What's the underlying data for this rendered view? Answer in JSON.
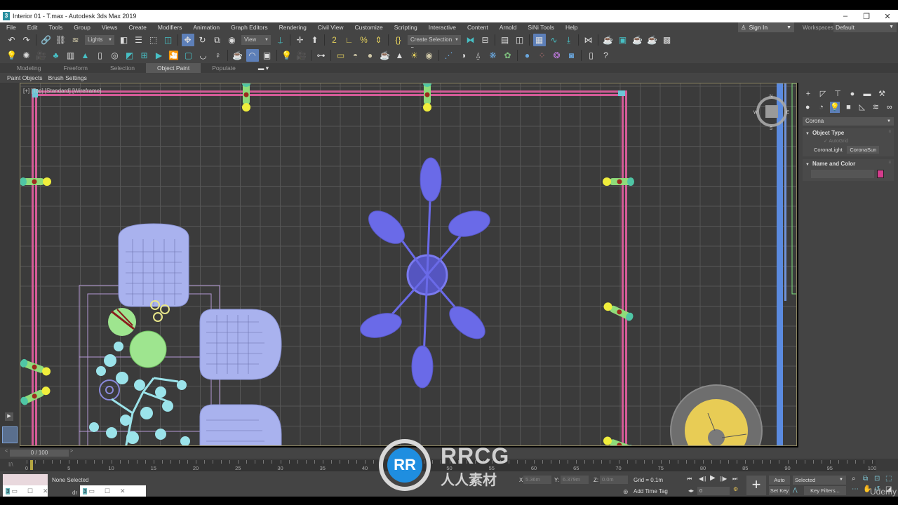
{
  "window": {
    "title": "Interior 01 - T.max - Autodesk 3ds Max 2019",
    "app_icon": "3",
    "controls": [
      "minimize-icon",
      "restore-icon",
      "close-icon"
    ]
  },
  "menu": {
    "items": [
      "File",
      "Edit",
      "Tools",
      "Group",
      "Views",
      "Create",
      "Modifiers",
      "Animation",
      "Graph Editors",
      "Rendering",
      "Civil View",
      "Customize",
      "Scripting",
      "Interactive",
      "Content",
      "Arnold",
      "SiNi Tools",
      "Help"
    ],
    "sign_in": "Sign In",
    "workspaces_label": "Workspaces:",
    "workspace_value": "Default"
  },
  "toolbar_main": {
    "selection_filter": "Lights",
    "ref_coord": "View",
    "named_selection": "Create Selection Se",
    "active_tool": "select-and-move"
  },
  "ribbon": {
    "tabs": [
      "Modeling",
      "Freeform",
      "Selection",
      "Object Paint",
      "Populate"
    ],
    "active_tab": "Object Paint",
    "sub_items": [
      "Paint Objects",
      "Brush Settings"
    ]
  },
  "viewport": {
    "label": "[+] [Top] [Standard] [Wireframe]",
    "viewcube_letters": {
      "n": "N",
      "s": "S",
      "e": "E",
      "w": "W"
    },
    "colors": {
      "background": "#3b3b3b",
      "grid": "#565656",
      "wall_pink": "#d45b97",
      "wall_blue": "#5b8be0",
      "chandelier": "#6a6ae8",
      "chair": "#a9b2ee",
      "plant": "#9be3ea",
      "green_disc": "#9ee58f",
      "yellow_light": "#f0ee3c",
      "lamp_globe": "#e8cc55"
    }
  },
  "command_panel": {
    "tabs": [
      "create",
      "modify",
      "hierarchy",
      "motion",
      "display",
      "utilities"
    ],
    "categories": [
      "geometry",
      "shapes",
      "lights",
      "cameras",
      "helpers",
      "space-warps",
      "systems"
    ],
    "active_category": "lights",
    "renderer_dropdown": "Corona",
    "object_type": {
      "title": "Object Type",
      "autogrid": "AutoGrid",
      "buttons": [
        "CoronaLight",
        "CoronaSun"
      ]
    },
    "name_and_color": {
      "title": "Name and Color",
      "name_value": "",
      "color": "#d43c8c"
    }
  },
  "timeline": {
    "slider_text": "0 / 100",
    "prev": "<",
    "next": ">",
    "ticks": [
      0,
      5,
      10,
      15,
      20,
      25,
      30,
      35,
      40,
      45,
      50,
      55,
      60,
      65,
      70,
      75,
      80,
      85,
      90,
      95,
      100
    ],
    "current_frame": 0
  },
  "status": {
    "selection": "None Selected",
    "x_label": "X:",
    "x_value": "5.36m",
    "y_label": "Y:",
    "y_value": "6.379m",
    "z_label": "Z:",
    "z_value": "0.0m",
    "grid": "Grid = 0.1m",
    "add_time_tag": "Add Time Tag",
    "frame_value": "0",
    "auto_key": "Auto Key",
    "set_key": "Set Key",
    "key_mode": "Selected",
    "key_filters": "Key Filters...",
    "taskbar_fragment": "dr"
  },
  "watermark": {
    "logo": "RR",
    "text_en": "RRCG",
    "text_cn": "人人素材",
    "udemy": "Udemy"
  }
}
